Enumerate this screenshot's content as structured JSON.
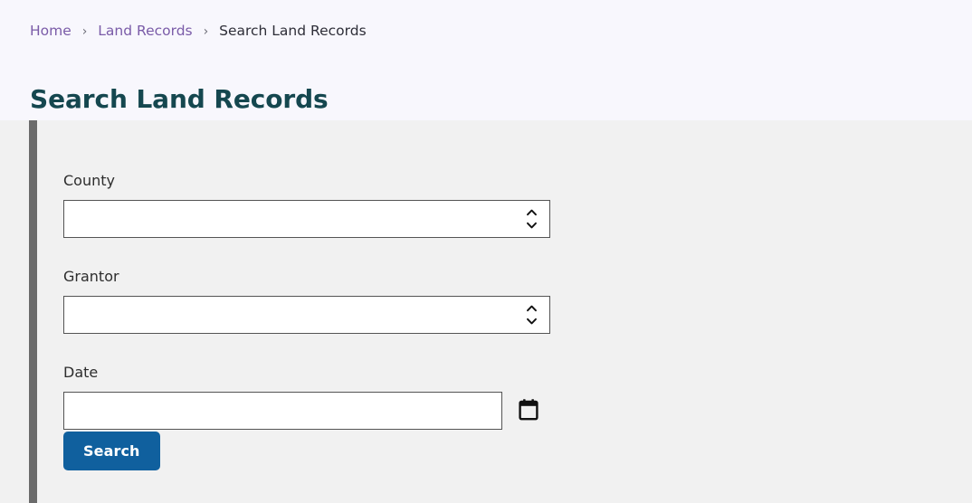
{
  "breadcrumb": {
    "items": [
      {
        "label": "Home",
        "is_link": true
      },
      {
        "label": "Land Records",
        "is_link": true
      },
      {
        "label": "Search Land Records",
        "is_link": false
      }
    ],
    "separator": "›"
  },
  "page": {
    "title": "Search Land Records"
  },
  "form": {
    "fields": [
      {
        "label": "County",
        "type": "select",
        "value": "",
        "placeholder": "",
        "icon": "chevron-updown-icon"
      },
      {
        "label": "Grantor",
        "type": "select",
        "value": "",
        "placeholder": "",
        "icon": "chevron-updown-icon"
      },
      {
        "label": "Date",
        "type": "date",
        "value": "",
        "placeholder": "",
        "icon": "calendar-icon"
      }
    ],
    "submit_label": "Search"
  },
  "colors": {
    "page_background": "#f8f7fd",
    "panel_background": "#f1f1f1",
    "accent_bar": "#6b6b6b",
    "title": "#15474f",
    "breadcrumb_link": "#7a5ba8",
    "breadcrumb_current": "#2e2e38",
    "button": "#10609e",
    "button_text": "#ffffff",
    "field_border": "#545454",
    "field_background": "#ffffff",
    "label_text": "#2d2d2d"
  }
}
